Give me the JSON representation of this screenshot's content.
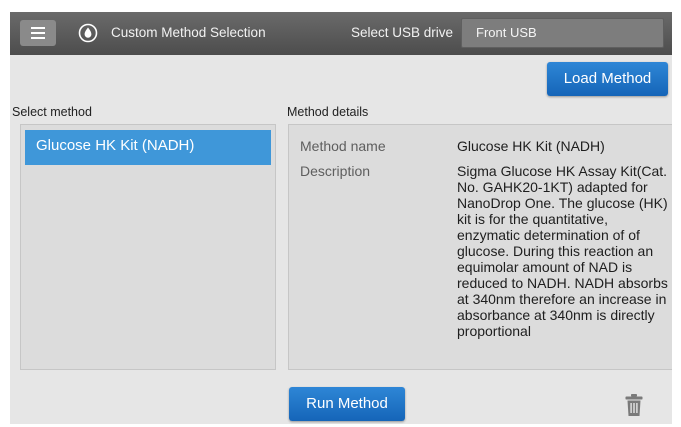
{
  "header": {
    "menu_icon": "menu-icon",
    "app_icon": "nanodrop-logo-icon",
    "title": "Custom Method Selection",
    "usb_label": "Select USB drive",
    "usb_value": "Front USB"
  },
  "actions": {
    "load_method": "Load Method",
    "run_method": "Run Method",
    "delete_icon": "trash-icon"
  },
  "select_method": {
    "label": "Select method",
    "items": [
      {
        "name": "Glucose HK Kit (NADH)",
        "selected": true
      }
    ]
  },
  "method_details": {
    "label": "Method details",
    "fields": [
      {
        "key": "Method name",
        "value": "Glucose HK Kit (NADH)"
      },
      {
        "key": "Description",
        "value": "Sigma Glucose HK Assay Kit(Cat. No. GAHK20-1KT) adapted for NanoDrop One. The glucose (HK) kit is for the quantitative, enzymatic determination of of glucose. During this reaction an equimolar amount of NAD is reduced to NADH.  NADH absorbs at 340nm therefore an increase in absorbance at 340nm is directly proportional"
      }
    ]
  },
  "colors": {
    "accent": "#1f7acb",
    "selected_item": "#3f97d9",
    "topbar": "#555555",
    "background": "#e6e6e6"
  }
}
